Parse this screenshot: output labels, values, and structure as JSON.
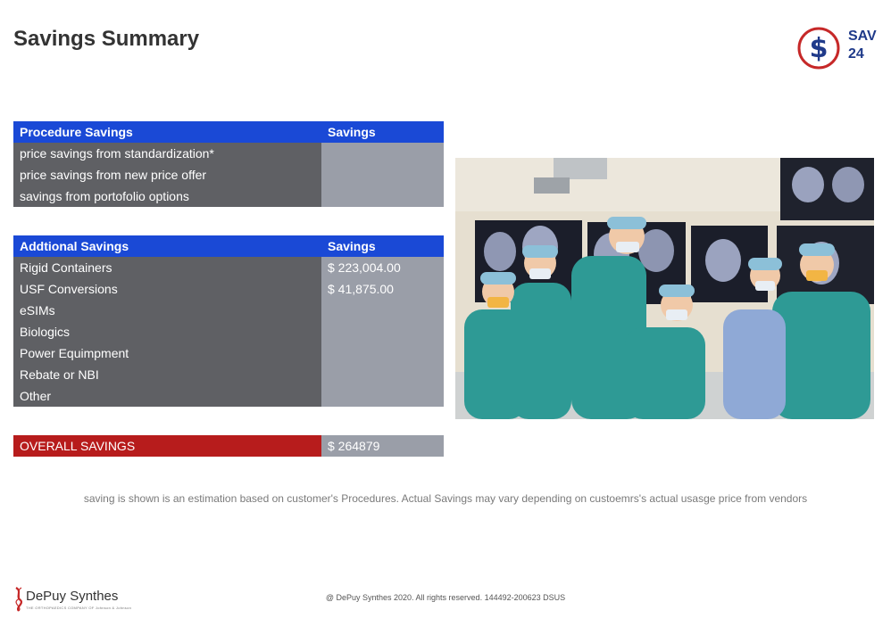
{
  "page": {
    "title": "Savings Summary"
  },
  "badge": {
    "line1": "SAV",
    "line2": "24",
    "icon": "dollar-circle-icon",
    "color": "#1f3a8a",
    "ring_color": "#c62828"
  },
  "procedure_table": {
    "header_label": "Procedure Savings",
    "header_value": "Savings",
    "rows": [
      {
        "label": "price savings from standardization*",
        "value": ""
      },
      {
        "label": "price savings from new price offer",
        "value": ""
      },
      {
        "label": "savings from portofolio options",
        "value": ""
      }
    ]
  },
  "additional_table": {
    "header_label": "Addtional Savings",
    "header_value": "Savings",
    "rows": [
      {
        "label": "Rigid Containers",
        "value": "$ 223,004.00"
      },
      {
        "label": "USF Conversions",
        "value": "$ 41,875.00"
      },
      {
        "label": "eSIMs",
        "value": ""
      },
      {
        "label": "Biologics",
        "value": ""
      },
      {
        "label": "Power Equimpment",
        "value": ""
      },
      {
        "label": "Rebate or NBI",
        "value": ""
      },
      {
        "label": "Other",
        "value": ""
      }
    ]
  },
  "overall": {
    "label": "OVERALL SAVINGS",
    "value": "$ 264879"
  },
  "disclaimer": "saving is shown is an estimation based on customer's Procedures. Actual Savings may vary depending on custoemrs's actual usasge price from vendors",
  "copyright": "@ DePuy Synthes 2020. All rights reserved. 144492-200623 DSUS",
  "logo": {
    "name": "DePuy Synthes",
    "tagline": "THE ORTHOPAEDICS COMPANY OF Johnson & Johnson"
  },
  "colors": {
    "header_blue": "#1a49d6",
    "label_gray": "#5f6064",
    "value_gray": "#9a9ea8",
    "overall_red": "#b71c1c"
  }
}
